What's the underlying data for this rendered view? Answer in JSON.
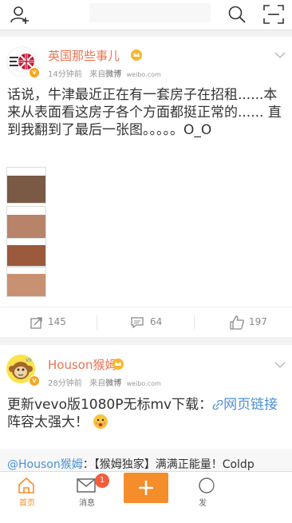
{
  "top_bar": {
    "search_placeholder": ""
  },
  "posts": [
    {
      "username": "英国那些事儿",
      "time": "14分钟前",
      "source_prefix": "来自",
      "source": "微博",
      "source_domain": "weibo.com",
      "text": "话说，牛津最近正在有一套房子在招租......本来从表面看这房子各个方面都挺正常的...... 直到我翻到了最后一张图。。。。。O_O",
      "actions": {
        "repost": "145",
        "comment": "64",
        "like": "197"
      }
    },
    {
      "username": "Houson猴姆",
      "time": "28分钟前",
      "source_prefix": "来自",
      "source": "微博",
      "source_domain": "weibo.com",
      "text_prefix": "更新vevo版1080P无标mv下载：",
      "link_text": "网页链接",
      "text_suffix": "阵容太强大！",
      "reply_user": "@Houson猴姆",
      "reply_text": "：【猴姆独家】满满正能量！Coldp"
    }
  ],
  "tabbar": {
    "home": "首页",
    "messages": "消息",
    "messages_badge": "1",
    "discover": "发"
  },
  "colors": {
    "accent": "#eb7350",
    "orange": "#f58d2b",
    "link": "#4a90d9",
    "badge": "#f45c3b"
  }
}
